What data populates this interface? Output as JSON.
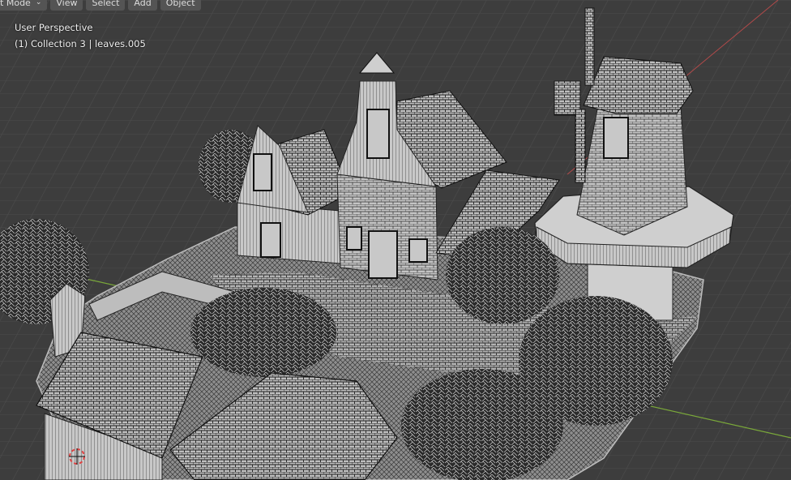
{
  "menu": {
    "mode_label": "ct Mode",
    "mode_chevron_icon": "chevron-down-icon",
    "view": "View",
    "select": "Select",
    "add": "Add",
    "object": "Object"
  },
  "viewport": {
    "perspective": "User Perspective",
    "collection": "(1) Collection 3 | leaves.005",
    "background_color": "#3d3d3d",
    "grid_color": "#4a4a4a",
    "x_axis_color": "#b34a4a",
    "y_axis_color": "#7aa83a"
  }
}
